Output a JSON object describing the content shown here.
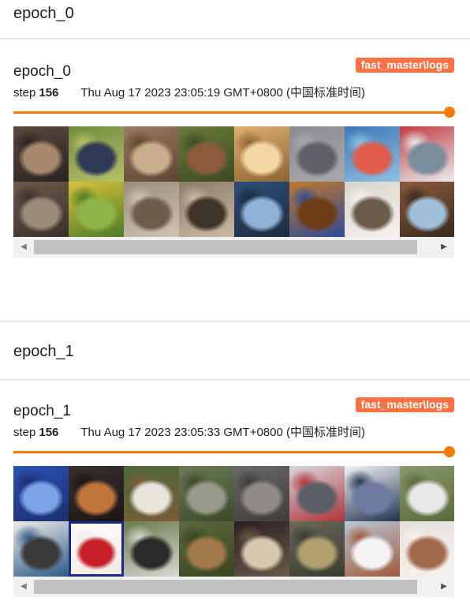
{
  "sections": [
    {
      "heading": "epoch_0",
      "card": {
        "title": "epoch_0",
        "run_badge": "fast_master\\logs",
        "step_label": "step",
        "step_value": "156",
        "timestamp": "Thu Aug 17 2023 23:05:19 GMT+0800 (中国标准时间)",
        "step_slider_position": 1.0,
        "images": [
          {
            "subject": "truck",
            "c1": "#5b4a3f",
            "c2": "#a78a6d",
            "c3": "#2a2220"
          },
          {
            "subject": "bird",
            "c1": "#6f8a3c",
            "c2": "#2e3a56",
            "c3": "#b7c06a"
          },
          {
            "subject": "bird",
            "c1": "#9d7a5e",
            "c2": "#c9ad8c",
            "c3": "#5c4634"
          },
          {
            "subject": "frog",
            "c1": "#6a7c3a",
            "c2": "#8b5a3c",
            "c3": "#3b4a22"
          },
          {
            "subject": "cat",
            "c1": "#e0b070",
            "c2": "#f3d6a2",
            "c3": "#8c6433"
          },
          {
            "subject": "cat",
            "c1": "#8a8a90",
            "c2": "#5f6068",
            "c3": "#a9a9ad"
          },
          {
            "subject": "ship",
            "c1": "#3d78b4",
            "c2": "#e25d4c",
            "c3": "#8ec0e4"
          },
          {
            "subject": "automobile",
            "c1": "#c33b3f",
            "c2": "#7b8c9c",
            "c3": "#e9eef2"
          },
          {
            "subject": "cat",
            "c1": "#6b5a4b",
            "c2": "#9b8b79",
            "c3": "#3b3029"
          },
          {
            "subject": "bird",
            "c1": "#d7c33a",
            "c2": "#8fb548",
            "c3": "#4e7a2a"
          },
          {
            "subject": "cat",
            "c1": "#9c8d7b",
            "c2": "#6f5d4a",
            "c3": "#cfc3b3"
          },
          {
            "subject": "bird",
            "c1": "#8b7b68",
            "c2": "#3e3528",
            "c3": "#cbbba3"
          },
          {
            "subject": "truck",
            "c1": "#2f4f7a",
            "c2": "#8fb2d8",
            "c3": "#1d2a3c"
          },
          {
            "subject": "dog",
            "c1": "#c07a2c",
            "c2": "#6e3d16",
            "c3": "#2e4a9a"
          },
          {
            "subject": "frog",
            "c1": "#d8d4cc",
            "c2": "#6b5b4a",
            "c3": "#f4f2ee"
          },
          {
            "subject": "horse",
            "c1": "#8a5a3a",
            "c2": "#9fc0d8",
            "c3": "#3a2a1e"
          }
        ]
      }
    },
    {
      "heading": "epoch_1",
      "card": {
        "title": "epoch_1",
        "run_badge": "fast_master\\logs",
        "step_label": "step",
        "step_value": "156",
        "timestamp": "Thu Aug 17 2023 23:05:33 GMT+0800 (中国标准时间)",
        "step_slider_position": 1.0,
        "images": [
          {
            "subject": "airplane",
            "c1": "#2a52b8",
            "c2": "#7aa4e6",
            "c3": "#1b2e6a"
          },
          {
            "subject": "cat",
            "c1": "#3a3030",
            "c2": "#c0763a",
            "c3": "#1a1515"
          },
          {
            "subject": "horse",
            "c1": "#4a6a3a",
            "c2": "#e8e4dc",
            "c3": "#7c5a3a"
          },
          {
            "subject": "cat",
            "c1": "#6c7a5a",
            "c2": "#9a9a8a",
            "c3": "#3c4a2a"
          },
          {
            "subject": "cat",
            "c1": "#6a6868",
            "c2": "#8e8b88",
            "c3": "#3f3d3c"
          },
          {
            "subject": "truck",
            "c1": "#d8d8dc",
            "c2": "#5a5e66",
            "c3": "#b0343a"
          },
          {
            "subject": "truck",
            "c1": "#f2f4f8",
            "c2": "#6e7aa0",
            "c3": "#22324e"
          },
          {
            "subject": "automobile",
            "c1": "#8a9a6a",
            "c2": "#e8e8e8",
            "c3": "#5a6a3a"
          },
          {
            "subject": "dog",
            "c1": "#f0ece8",
            "c2": "#3a3a3a",
            "c3": "#2a5a8a"
          },
          {
            "subject": "automobile",
            "c1": "#ffffff",
            "c2": "#c8202a",
            "c3": "#f0e8e8"
          },
          {
            "subject": "horse",
            "c1": "#6a7a4a",
            "c2": "#2a2a2a",
            "c3": "#d8d8d0"
          },
          {
            "subject": "deer",
            "c1": "#5a6a3a",
            "c2": "#a07a4a",
            "c3": "#3a4422"
          },
          {
            "subject": "dog",
            "c1": "#2a2020",
            "c2": "#d8c8b0",
            "c3": "#6a5a4a"
          },
          {
            "subject": "frog",
            "c1": "#6a6a5a",
            "c2": "#b0a070",
            "c3": "#3a3a30"
          },
          {
            "subject": "dog",
            "c1": "#b8c8d8",
            "c2": "#f4f4f4",
            "c3": "#a05a3a"
          },
          {
            "subject": "horse",
            "c1": "#e6e0da",
            "c2": "#a06a4a",
            "c3": "#f4f2f0"
          }
        ],
        "selected_image_index": 9
      }
    }
  ],
  "colors": {
    "accent": "#f57c00",
    "badge": "#ff7043",
    "selected_border": "#1a2a8c"
  }
}
